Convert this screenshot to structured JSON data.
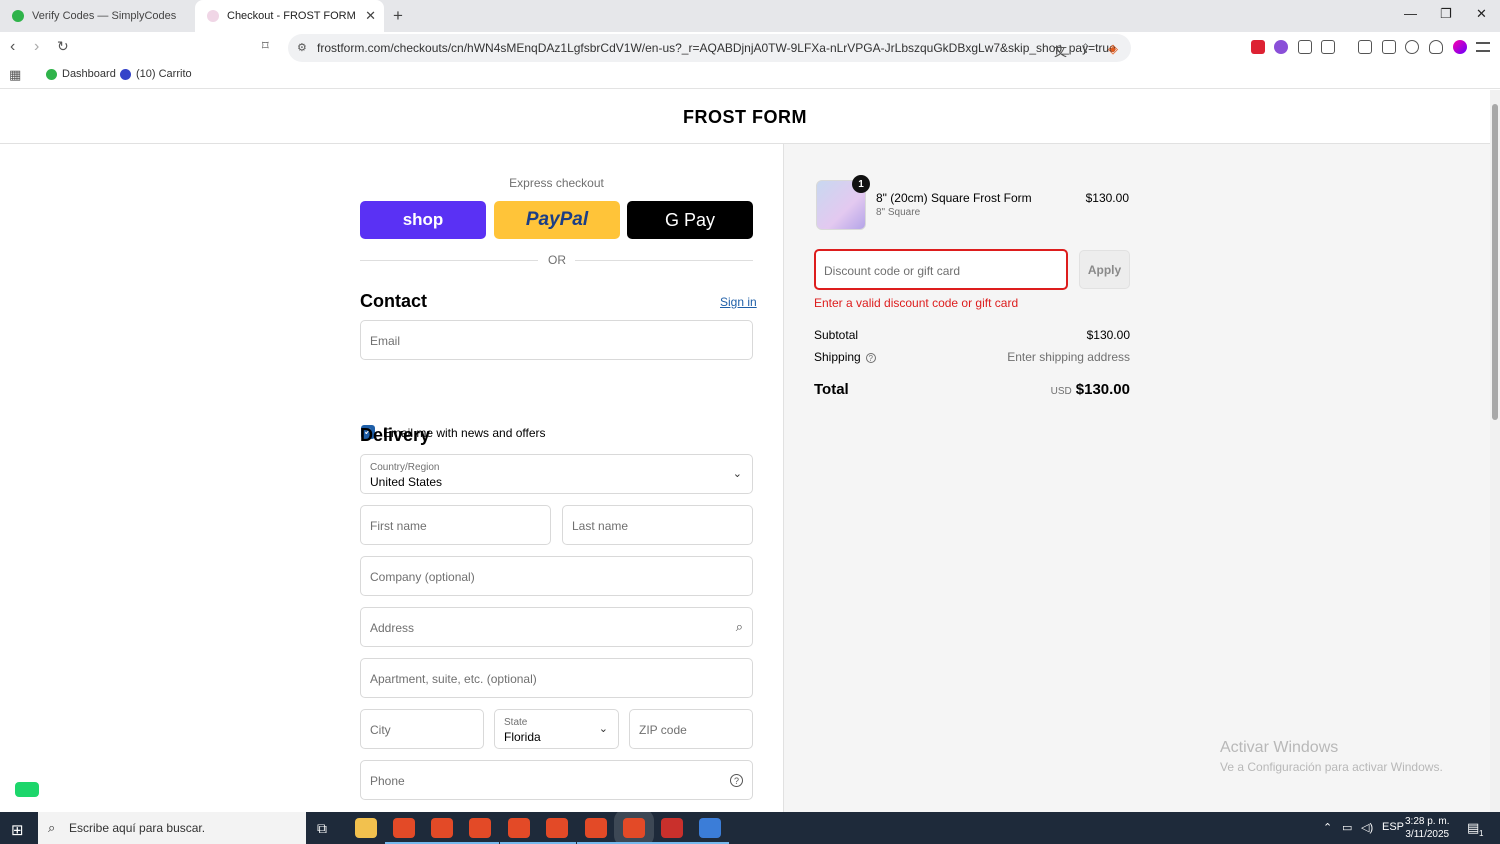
{
  "browser": {
    "tabs": [
      {
        "title": "Verify Codes — SimplyCodes"
      },
      {
        "title": "Checkout - FROST FORM"
      }
    ],
    "url": "frostform.com/checkouts/cn/hWN4sMEnqDAz1LgfsbrCdV1W/en-us?_r=AQABDjnjA0TW-9LFXa-nLrVPGA-JrLbszquGkDBxgLw7&skip_shop_pay=true",
    "bookmarks": [
      {
        "label": "Dashboard"
      },
      {
        "label": "(10) Carrito"
      }
    ]
  },
  "store": {
    "name": "FROST FORM"
  },
  "checkout": {
    "express_label": "Express checkout",
    "shop_label": "shop",
    "paypal_label": "PayPal",
    "gpay_label": "G Pay",
    "or_label": "OR",
    "contact_heading": "Contact",
    "sign_in": "Sign in",
    "email_placeholder": "Email",
    "news_checkbox_label": "Email me with news and offers",
    "news_checked": true,
    "delivery_heading": "Delivery",
    "country_label": "Country/Region",
    "country_value": "United States",
    "first_name_placeholder": "First name",
    "last_name_placeholder": "Last name",
    "company_placeholder": "Company (optional)",
    "address_placeholder": "Address",
    "apartment_placeholder": "Apartment, suite, etc. (optional)",
    "city_placeholder": "City",
    "state_label": "State",
    "state_value": "Florida",
    "zip_placeholder": "ZIP code",
    "phone_placeholder": "Phone"
  },
  "summary": {
    "item": {
      "quantity": "1",
      "name": "8\" (20cm) Square Frost Form",
      "variant": "8\" Square",
      "price": "$130.00"
    },
    "discount_placeholder": "Discount code or gift card",
    "apply_label": "Apply",
    "discount_error": "Enter a valid discount code or gift card",
    "subtotal_label": "Subtotal",
    "subtotal_value": "$130.00",
    "shipping_label": "Shipping",
    "shipping_value": "Enter shipping address",
    "total_label": "Total",
    "currency": "USD",
    "total_value": "$130.00",
    "error_color": "#dd1d1d"
  },
  "watermark": {
    "line1": "Activar Windows",
    "line2": "Ve a Configuración para activar Windows."
  },
  "taskbar": {
    "search_placeholder": "Escribe aquí para buscar.",
    "language": "ESP",
    "time": "3:28 p. m.",
    "date": "3/11/2025",
    "notification_count": "1"
  }
}
